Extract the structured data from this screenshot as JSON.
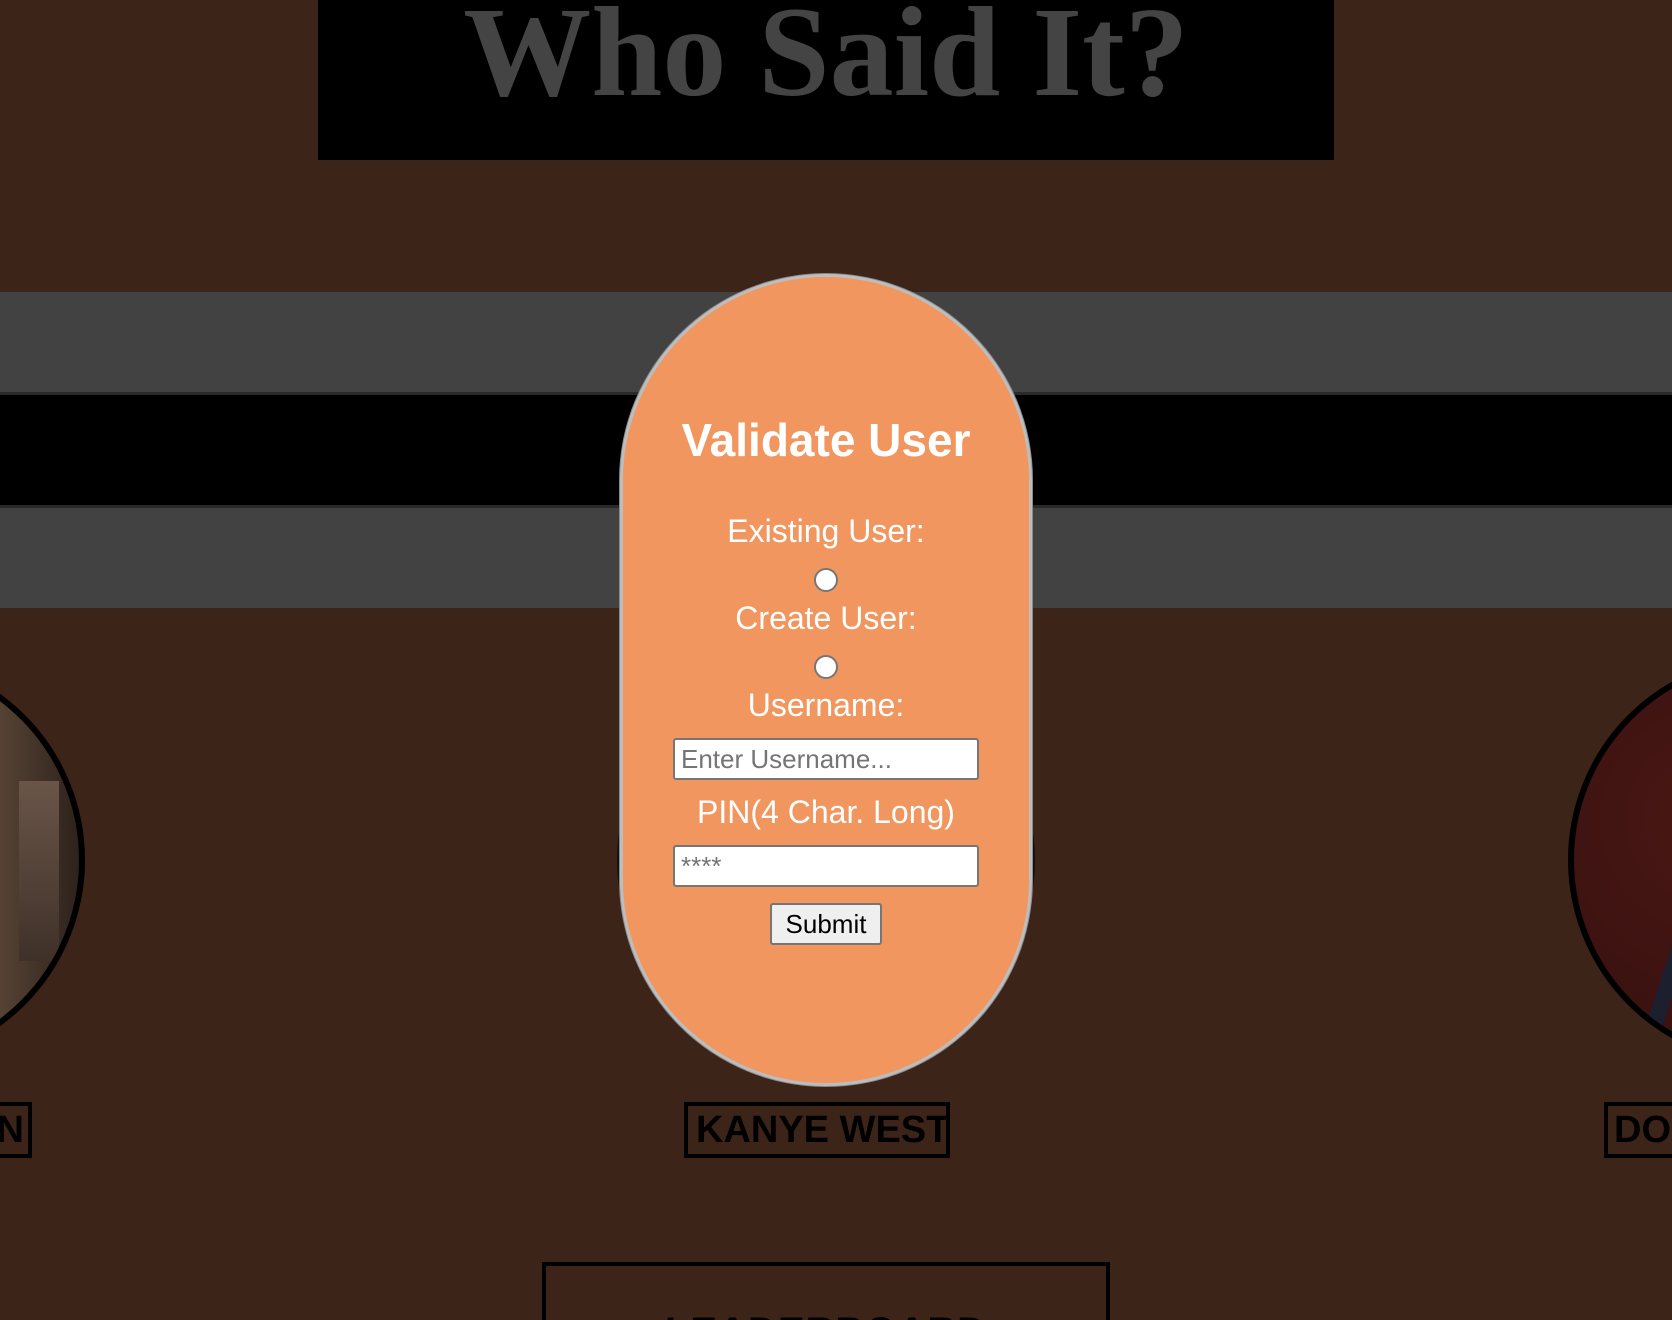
{
  "header": {
    "title": "Who Said It?"
  },
  "celebrities": [
    {
      "name": "N"
    },
    {
      "name": "KANYE WEST"
    },
    {
      "name": "DO"
    }
  ],
  "leaderboard": {
    "label": "LEADERBOARD"
  },
  "modal": {
    "title": "Validate User",
    "existing_label": "Existing User:",
    "create_label": "Create User:",
    "username_label": "Username:",
    "username_placeholder": "Enter Username...",
    "pin_label": "PIN(4 Char. Long)",
    "pin_placeholder": "****",
    "submit_label": "Submit"
  },
  "colors": {
    "background": "#3d2419",
    "modal": "#f1965e",
    "stripe_gray": "#424242"
  }
}
